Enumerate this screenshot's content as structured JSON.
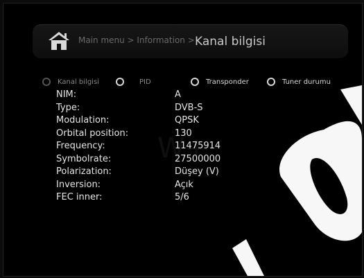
{
  "header": {
    "breadcrumb": "Main menu > Information >",
    "title": "Kanal bilgisi",
    "home_icon": "home-icon"
  },
  "tabs": [
    {
      "label": "Kanal bilgisi",
      "active": false
    },
    {
      "label": "PID",
      "active": false
    },
    {
      "label": "Transponder",
      "active": true
    },
    {
      "label": "Tuner durumu",
      "active": false
    }
  ],
  "info": [
    {
      "label": "NIM:",
      "value": "A"
    },
    {
      "label": "Type:",
      "value": "DVB-S"
    },
    {
      "label": "Modulation:",
      "value": "QPSK"
    },
    {
      "label": "Orbital position:",
      "value": "130"
    },
    {
      "label": "Frequency:",
      "value": "11475914"
    },
    {
      "label": "Symbolrate:",
      "value": "27500000"
    },
    {
      "label": "Polarization:",
      "value": "Düşey (V)"
    },
    {
      "label": "Inversion:",
      "value": "Açık"
    },
    {
      "label": "FEC inner:",
      "value": "5/6"
    }
  ],
  "colors": {
    "background": "#000000",
    "text": "#e6e6e6",
    "breadcrumb": "#6a6a6a",
    "watermark": "#ffffff"
  }
}
